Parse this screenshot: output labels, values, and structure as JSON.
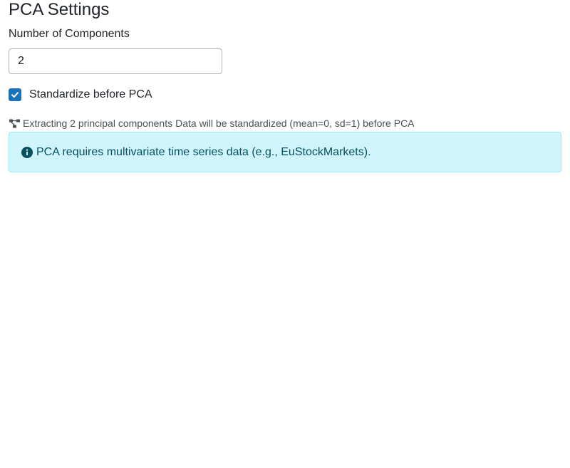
{
  "settings": {
    "title": "PCA Settings",
    "components_label": "Number of Components",
    "components_value": "2",
    "standardize_label": "Standardize before PCA",
    "standardize_checked": true
  },
  "summary": {
    "icon": "project-diagram-icon",
    "components_text": "Extracting 2 principal components",
    "standardize_text": "Data will be standardized (mean=0, sd=1) before PCA"
  },
  "alert": {
    "icon": "info-circle-icon",
    "text": "PCA requires multivariate time series data (e.g., EuStockMarkets)."
  },
  "colors": {
    "accent": "#1a73b8",
    "alert_bg": "#cff4fc",
    "alert_border": "#9eeaf9",
    "alert_text": "#055160"
  }
}
